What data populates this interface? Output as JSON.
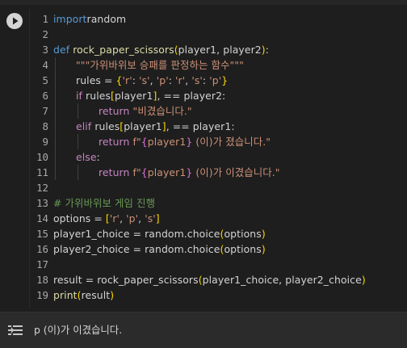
{
  "cell": {
    "run_icon": "play-circle-icon",
    "lines": [
      {
        "n": "1",
        "parts": [
          [
            "kw2",
            "import"
          ],
          [
            "",
            "random"
          ]
        ]
      },
      {
        "n": "2",
        "parts": []
      },
      {
        "n": "3",
        "parts": [
          [
            "kw2",
            "def "
          ],
          [
            "fn",
            "rock_paper_scissors"
          ],
          [
            "br1",
            "("
          ],
          [
            "",
            "player1, player2"
          ],
          [
            "br1",
            ")"
          ],
          [
            "",
            ":"
          ]
        ]
      },
      {
        "n": "4",
        "parts": [
          [
            "str",
            "\"\"\"가위바위보 승패를 판정하는 함수\"\"\""
          ]
        ]
      },
      {
        "n": "5",
        "parts": [
          [
            "",
            "rules = "
          ],
          [
            "br1",
            "{"
          ],
          [
            "str",
            "'r'"
          ],
          [
            "",
            ": "
          ],
          [
            "str",
            "'s'"
          ],
          [
            "",
            ", "
          ],
          [
            "str",
            "'p'"
          ],
          [
            "",
            ": "
          ],
          [
            "str",
            "'r'"
          ],
          [
            "",
            ", "
          ],
          [
            "str",
            "'s'"
          ],
          [
            "",
            ": "
          ],
          [
            "str",
            "'p'"
          ],
          [
            "br1",
            "}"
          ]
        ]
      },
      {
        "n": "6",
        "parts": [
          [
            "kw",
            "if "
          ],
          [
            "",
            "rules"
          ],
          [
            "br1",
            "["
          ],
          [
            "",
            "player1"
          ],
          [
            "br1",
            "]"
          ],
          [
            "",
            ", == player2:"
          ]
        ]
      },
      {
        "n": "7",
        "parts": [
          [
            "kw",
            "return "
          ],
          [
            "str",
            "\"비겼습니다.\""
          ]
        ]
      },
      {
        "n": "8",
        "parts": [
          [
            "kw",
            "elif "
          ],
          [
            "",
            "rules"
          ],
          [
            "br1",
            "["
          ],
          [
            "",
            "player1"
          ],
          [
            "br1",
            "]"
          ],
          [
            "",
            ", == player1:"
          ]
        ]
      },
      {
        "n": "9",
        "parts": [
          [
            "kw",
            "return "
          ],
          [
            "str",
            "f\""
          ],
          [
            "br2",
            "{"
          ],
          [
            "str",
            "player1"
          ],
          [
            "br2",
            "}"
          ],
          [
            "str",
            " (이)가 졌습니다.\""
          ]
        ]
      },
      {
        "n": "10",
        "parts": [
          [
            "kw",
            "else"
          ],
          [
            "",
            ":"
          ]
        ]
      },
      {
        "n": "11",
        "parts": [
          [
            "kw",
            "return "
          ],
          [
            "str",
            "f\""
          ],
          [
            "br2",
            "{"
          ],
          [
            "str",
            "player1"
          ],
          [
            "br2",
            "}"
          ],
          [
            "str",
            " (이)가 이겼습니다.\""
          ]
        ]
      },
      {
        "n": "12",
        "parts": []
      },
      {
        "n": "13",
        "parts": [
          [
            "cmt",
            "# 가위바위보 게임 진행"
          ]
        ]
      },
      {
        "n": "14",
        "parts": [
          [
            "",
            "options = "
          ],
          [
            "br1",
            "["
          ],
          [
            "str",
            "'r'"
          ],
          [
            "",
            ", "
          ],
          [
            "str",
            "'p'"
          ],
          [
            "",
            ", "
          ],
          [
            "str",
            "'s'"
          ],
          [
            "br1",
            "]"
          ]
        ]
      },
      {
        "n": "15",
        "parts": [
          [
            "",
            "player1_choice = random.choice"
          ],
          [
            "br1",
            "("
          ],
          [
            "",
            "options"
          ],
          [
            "br1",
            ")"
          ]
        ]
      },
      {
        "n": "16",
        "parts": [
          [
            "",
            "player2_choice = random.choice"
          ],
          [
            "br1",
            "("
          ],
          [
            "",
            "options"
          ],
          [
            "br1",
            ")"
          ]
        ]
      },
      {
        "n": "17",
        "parts": []
      },
      {
        "n": "18",
        "parts": [
          [
            "",
            "result = rock_paper_scissors"
          ],
          [
            "br1",
            "("
          ],
          [
            "",
            "player1_choice, player2_choice"
          ],
          [
            "br1",
            ")"
          ]
        ]
      },
      {
        "n": "19",
        "parts": [
          [
            "fn",
            "print"
          ],
          [
            "br1",
            "("
          ],
          [
            "",
            "result"
          ],
          [
            "br1",
            ")"
          ]
        ]
      }
    ]
  },
  "output": {
    "icon": "output-settings-icon",
    "text": "p (이)가 이겼습니다."
  }
}
